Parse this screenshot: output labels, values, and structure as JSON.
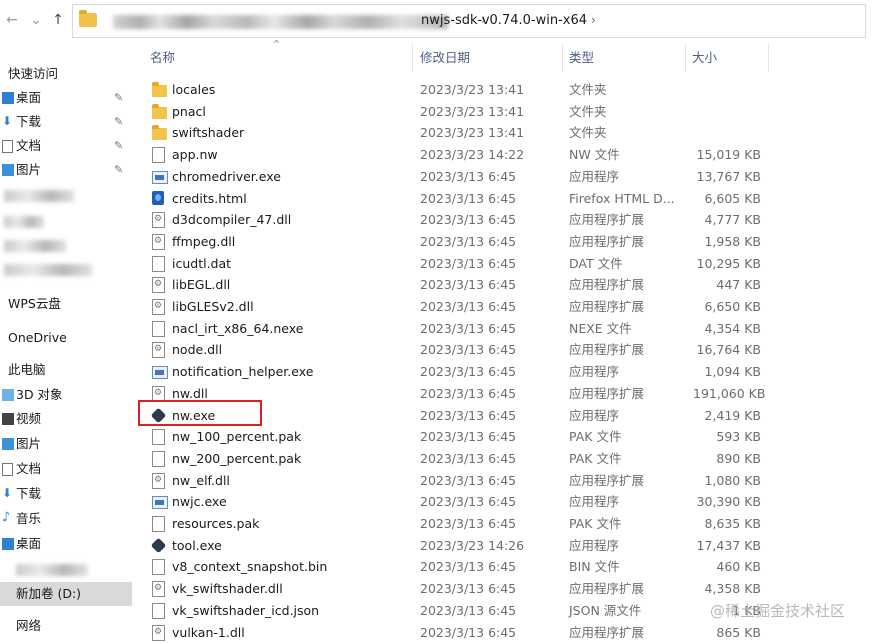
{
  "address": {
    "current_folder": "nwjs-sdk-v0.74.0-win-x64"
  },
  "nav": {
    "items": [
      {
        "label": "快速访问",
        "icon": "star-icon",
        "pinned": false
      },
      {
        "label": "桌面",
        "icon": "desktop-icon",
        "pinned": true
      },
      {
        "label": "下载",
        "icon": "download-icon",
        "pinned": true
      },
      {
        "label": "文档",
        "icon": "document-icon",
        "pinned": true
      },
      {
        "label": "图片",
        "icon": "pictures-icon",
        "pinned": true
      },
      {
        "label": "WPS云盘",
        "icon": "cloud-icon",
        "pinned": false
      },
      {
        "label": "OneDrive",
        "icon": "onedrive-icon",
        "pinned": false
      },
      {
        "label": "此电脑",
        "icon": "computer-icon",
        "pinned": false
      },
      {
        "label": "3D 对象",
        "icon": "cube-icon",
        "pinned": false
      },
      {
        "label": "视频",
        "icon": "video-icon",
        "pinned": false
      },
      {
        "label": "图片",
        "icon": "pictures-icon",
        "pinned": false
      },
      {
        "label": "文档",
        "icon": "document-icon",
        "pinned": false
      },
      {
        "label": "下载",
        "icon": "download-icon",
        "pinned": false
      },
      {
        "label": "音乐",
        "icon": "music-icon",
        "pinned": false
      },
      {
        "label": "桌面",
        "icon": "desktop-icon",
        "pinned": false
      },
      {
        "label": "新加卷 (D:)",
        "icon": "drive-icon",
        "pinned": false
      },
      {
        "label": "网络",
        "icon": "network-icon",
        "pinned": false
      }
    ]
  },
  "columns": {
    "name": "名称",
    "date": "修改日期",
    "type": "类型",
    "size": "大小"
  },
  "files": [
    {
      "name": "locales",
      "date": "2023/3/23 13:41",
      "type": "文件夹",
      "size": "",
      "icon": "folder"
    },
    {
      "name": "pnacl",
      "date": "2023/3/23 13:41",
      "type": "文件夹",
      "size": "",
      "icon": "folder"
    },
    {
      "name": "swiftshader",
      "date": "2023/3/23 13:41",
      "type": "文件夹",
      "size": "",
      "icon": "folder"
    },
    {
      "name": "app.nw",
      "date": "2023/3/23 14:22",
      "type": "NW 文件",
      "size": "15,019 KB",
      "icon": "file"
    },
    {
      "name": "chromedriver.exe",
      "date": "2023/3/13 6:45",
      "type": "应用程序",
      "size": "13,767 KB",
      "icon": "app"
    },
    {
      "name": "credits.html",
      "date": "2023/3/13 6:45",
      "type": "Firefox HTML D...",
      "size": "6,605 KB",
      "icon": "html"
    },
    {
      "name": "d3dcompiler_47.dll",
      "date": "2023/3/13 6:45",
      "type": "应用程序扩展",
      "size": "4,777 KB",
      "icon": "dll"
    },
    {
      "name": "ffmpeg.dll",
      "date": "2023/3/13 6:45",
      "type": "应用程序扩展",
      "size": "1,958 KB",
      "icon": "dll"
    },
    {
      "name": "icudtl.dat",
      "date": "2023/3/13 6:45",
      "type": "DAT 文件",
      "size": "10,295 KB",
      "icon": "file"
    },
    {
      "name": "libEGL.dll",
      "date": "2023/3/13 6:45",
      "type": "应用程序扩展",
      "size": "447 KB",
      "icon": "dll"
    },
    {
      "name": "libGLESv2.dll",
      "date": "2023/3/13 6:45",
      "type": "应用程序扩展",
      "size": "6,650 KB",
      "icon": "dll"
    },
    {
      "name": "nacl_irt_x86_64.nexe",
      "date": "2023/3/13 6:45",
      "type": "NEXE 文件",
      "size": "4,354 KB",
      "icon": "file"
    },
    {
      "name": "node.dll",
      "date": "2023/3/13 6:45",
      "type": "应用程序扩展",
      "size": "16,764 KB",
      "icon": "dll"
    },
    {
      "name": "notification_helper.exe",
      "date": "2023/3/13 6:45",
      "type": "应用程序",
      "size": "1,094 KB",
      "icon": "app"
    },
    {
      "name": "nw.dll",
      "date": "2023/3/13 6:45",
      "type": "应用程序扩展",
      "size": "191,060 KB",
      "icon": "dll"
    },
    {
      "name": "nw.exe",
      "date": "2023/3/13 6:45",
      "type": "应用程序",
      "size": "2,419 KB",
      "icon": "nw"
    },
    {
      "name": "nw_100_percent.pak",
      "date": "2023/3/13 6:45",
      "type": "PAK 文件",
      "size": "593 KB",
      "icon": "file"
    },
    {
      "name": "nw_200_percent.pak",
      "date": "2023/3/13 6:45",
      "type": "PAK 文件",
      "size": "890 KB",
      "icon": "file"
    },
    {
      "name": "nw_elf.dll",
      "date": "2023/3/13 6:45",
      "type": "应用程序扩展",
      "size": "1,080 KB",
      "icon": "dll"
    },
    {
      "name": "nwjc.exe",
      "date": "2023/3/13 6:45",
      "type": "应用程序",
      "size": "30,390 KB",
      "icon": "app"
    },
    {
      "name": "resources.pak",
      "date": "2023/3/13 6:45",
      "type": "PAK 文件",
      "size": "8,635 KB",
      "icon": "file"
    },
    {
      "name": "tool.exe",
      "date": "2023/3/23 14:26",
      "type": "应用程序",
      "size": "17,437 KB",
      "icon": "nw"
    },
    {
      "name": "v8_context_snapshot.bin",
      "date": "2023/3/13 6:45",
      "type": "BIN 文件",
      "size": "460 KB",
      "icon": "file"
    },
    {
      "name": "vk_swiftshader.dll",
      "date": "2023/3/13 6:45",
      "type": "应用程序扩展",
      "size": "4,358 KB",
      "icon": "dll"
    },
    {
      "name": "vk_swiftshader_icd.json",
      "date": "2023/3/13 6:45",
      "type": "JSON 源文件",
      "size": "1 KB",
      "icon": "file"
    },
    {
      "name": "vulkan-1.dll",
      "date": "2023/3/13 6:45",
      "type": "应用程序扩展",
      "size": "865 KB",
      "icon": "dll"
    }
  ],
  "watermark": "@稀土掘金技术社区",
  "colors": {
    "highlight": "#e02020",
    "header_text": "#4d6082",
    "selected_nav": "#d9d9d9"
  }
}
